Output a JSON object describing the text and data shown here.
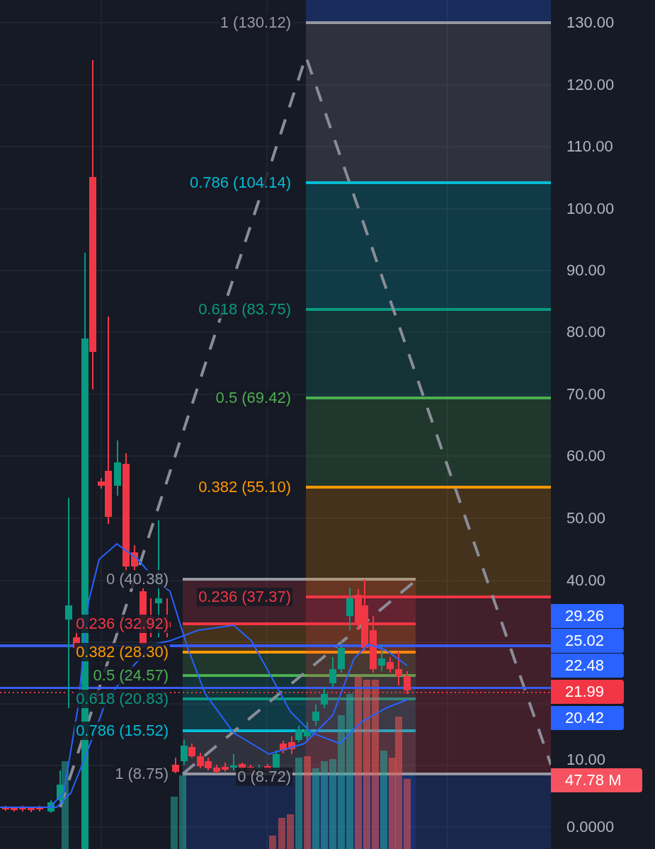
{
  "fib_retracements": [
    {
      "levels": [
        {
          "label": "0 (40.38)",
          "color": "#9598a1"
        },
        {
          "label": "0.236 (32.92)",
          "color": "#f23645"
        },
        {
          "label": "0.382 (28.30)",
          "color": "#ff9800"
        },
        {
          "label": "0.5 (24.57)",
          "color": "#4caf50"
        },
        {
          "label": "0.618 (20.83)",
          "color": "#089981"
        },
        {
          "label": "0.786 (15.52)",
          "color": "#00bcd4"
        },
        {
          "label": "1 (8.75)",
          "color": "#9598a1"
        }
      ]
    },
    {
      "levels": [
        {
          "label": "1 (130.12)",
          "color": "#9598a1"
        },
        {
          "label": "0.786 (104.14)",
          "color": "#00bcd4"
        },
        {
          "label": "0.618 (83.75)",
          "color": "#089981"
        },
        {
          "label": "0.5 (69.42)",
          "color": "#4caf50"
        },
        {
          "label": "0.382 (55.10)",
          "color": "#ff9800"
        },
        {
          "label": "0.236 (37.37)",
          "color": "#f23645"
        },
        {
          "label": "0 (8.72)",
          "color": "#9598a1"
        }
      ]
    }
  ],
  "price_axis": {
    "labels": [
      "130.00",
      "120.00",
      "110.00",
      "100.00",
      "90.00",
      "80.00",
      "70.00",
      "60.00",
      "50.00",
      "40.00",
      "10.00",
      "0.0000"
    ],
    "price_tags": [
      {
        "text": "29.26",
        "color": "#2962ff"
      },
      {
        "text": "25.02",
        "color": "#2962ff"
      },
      {
        "text": "22.48",
        "color": "#2962ff"
      },
      {
        "text": "21.99",
        "color": "#f23645"
      },
      {
        "text": "20.42",
        "color": "#2962ff"
      }
    ],
    "volume_tag": {
      "text": "47.78 M",
      "color": "#f7525f"
    }
  }
}
